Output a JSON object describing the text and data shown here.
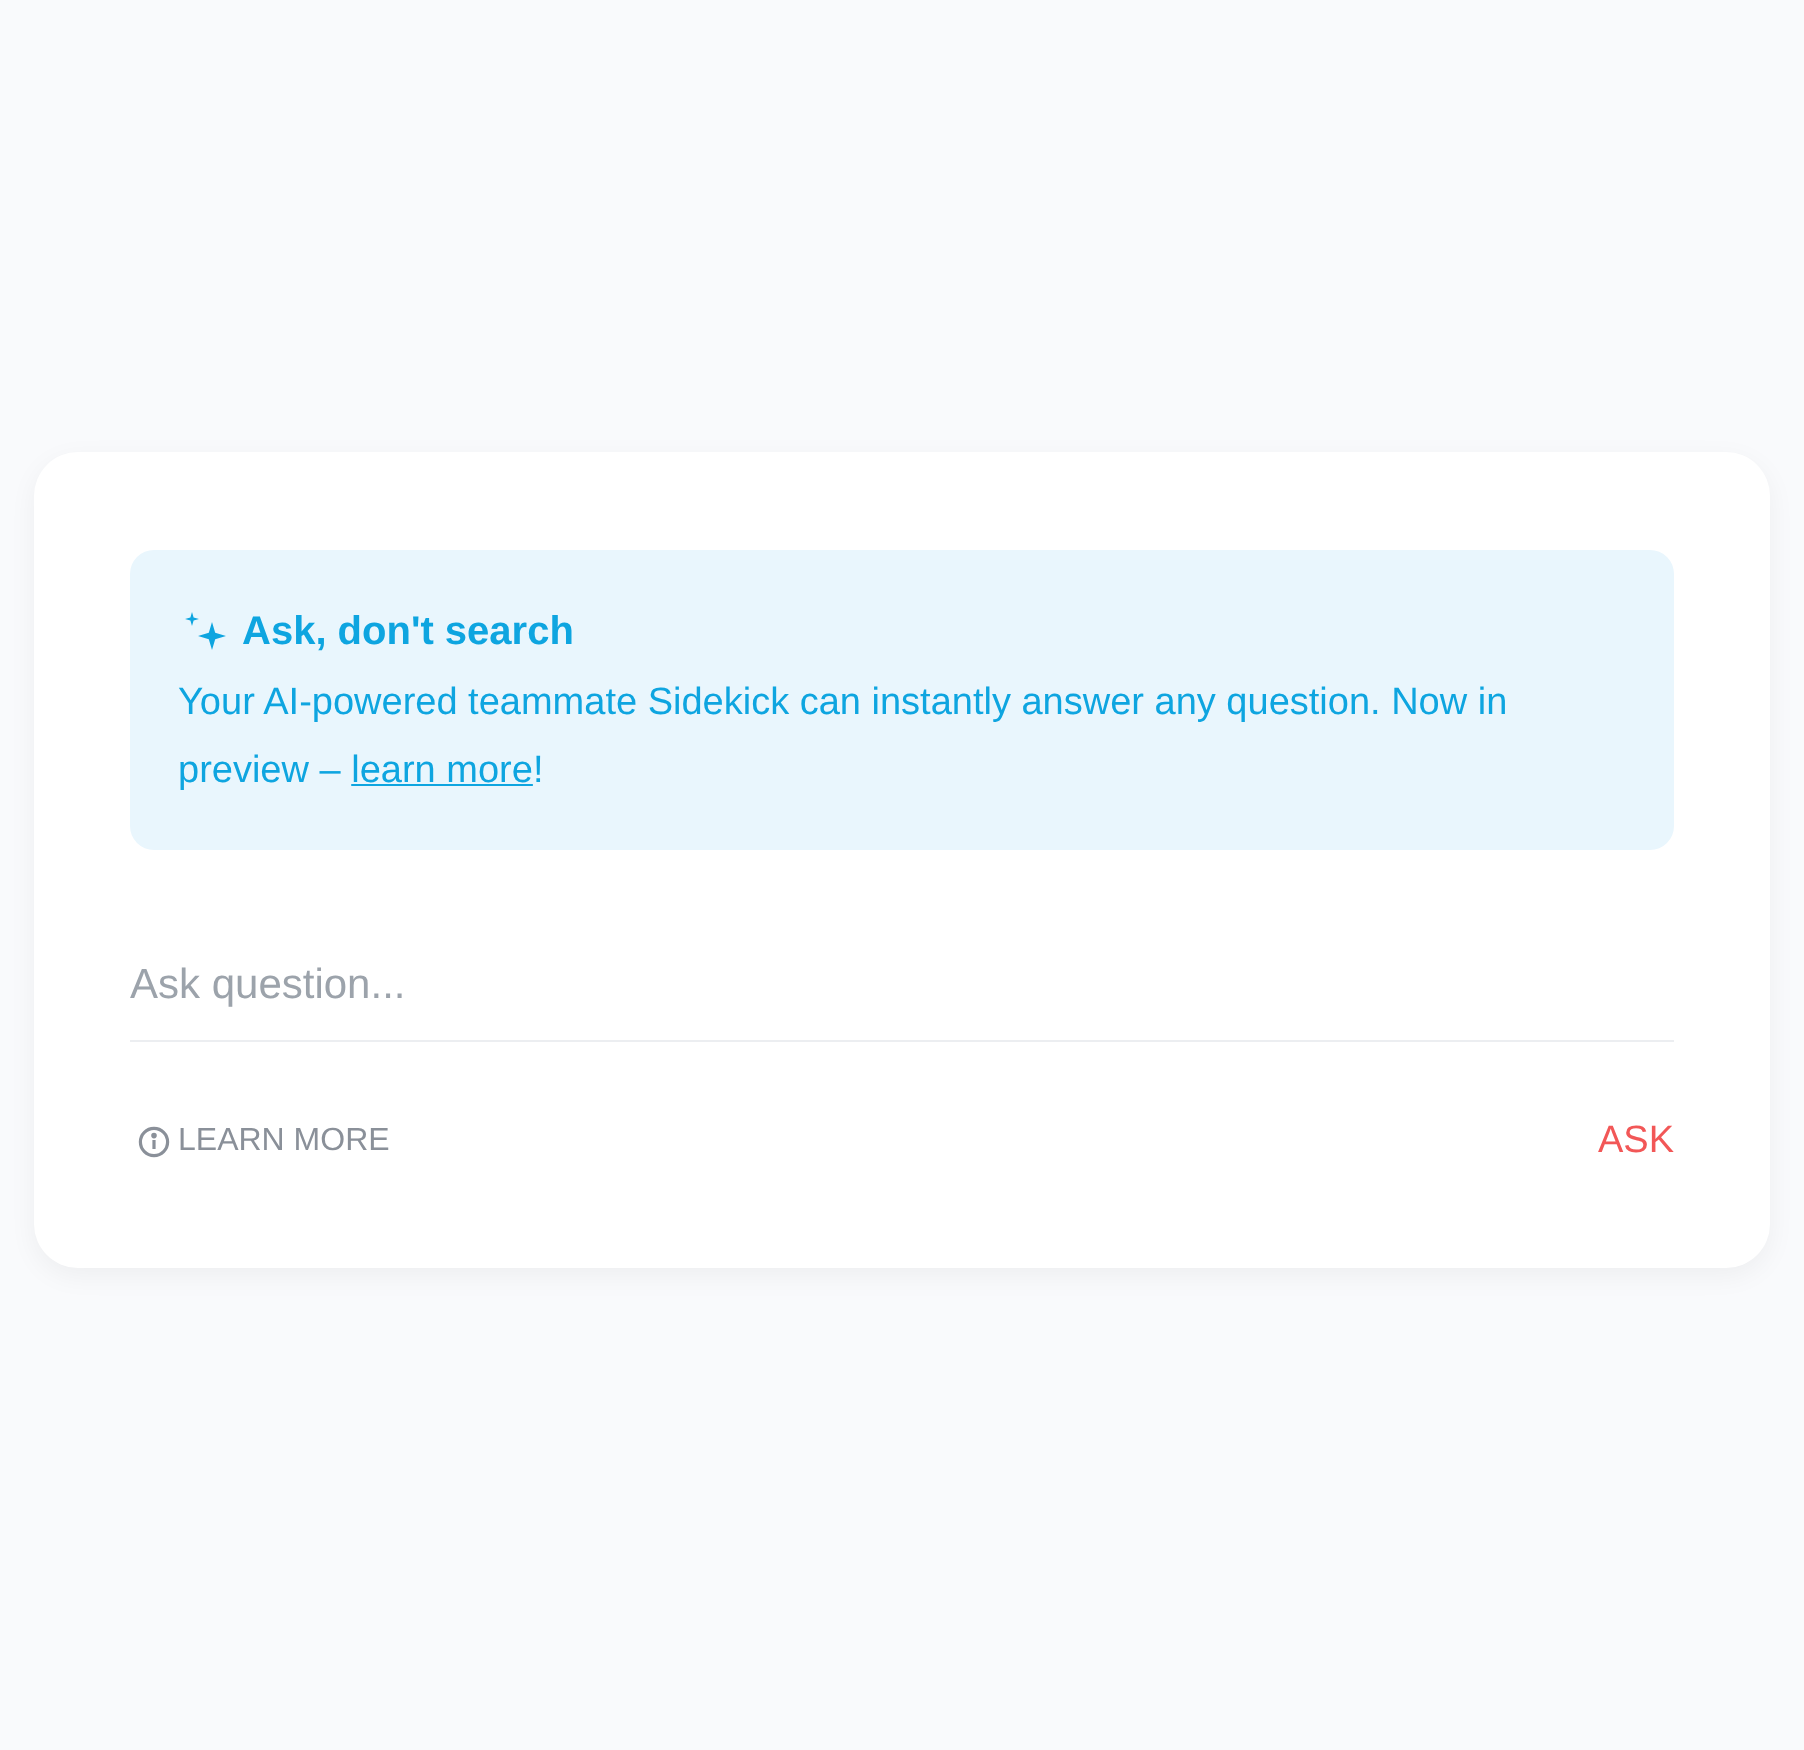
{
  "banner": {
    "title": "Ask, don't search",
    "text": "Your AI-powered teammate Sidekick can instantly answer any question. Now in preview – ",
    "link": "learn more",
    "text_end": "!"
  },
  "question_field": {
    "placeholder": "Ask question..."
  },
  "learn_more_button": "LEARN MORE",
  "ask_button": "ASK"
}
